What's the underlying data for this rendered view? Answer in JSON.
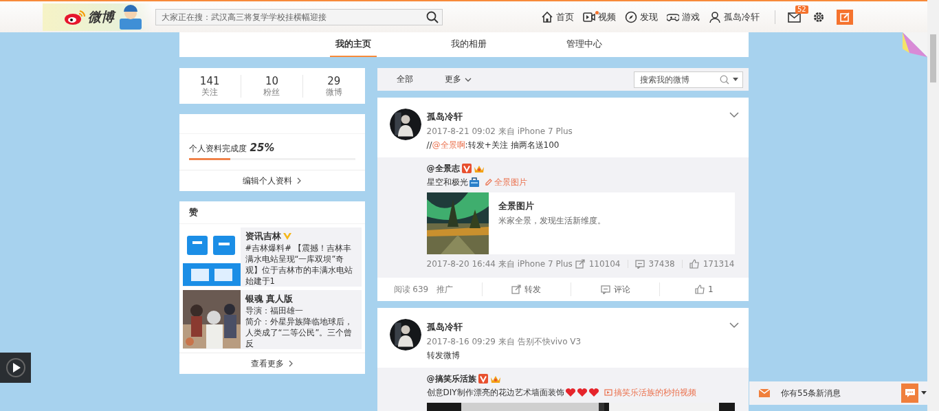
{
  "header": {
    "logo_text": "微博",
    "search": {
      "placeholder": "大家正在搜：武汉高三将复学学校挂横幅迎接"
    },
    "nav": [
      {
        "kind": "home",
        "label": "首页",
        "dot": false
      },
      {
        "kind": "video",
        "label": "视频",
        "dot": true
      },
      {
        "kind": "discover",
        "label": "发现",
        "dot": false
      },
      {
        "kind": "game",
        "label": "游戏",
        "dot": false
      },
      {
        "kind": "user",
        "label": "孤岛冷轩",
        "dot": false
      }
    ],
    "message_badge": "52"
  },
  "tabs": [
    {
      "label": "我的主页",
      "selected": true
    },
    {
      "label": "我的相册",
      "selected": false
    },
    {
      "label": "管理中心",
      "selected": false
    }
  ],
  "stats": [
    {
      "value": "141",
      "label": "关注"
    },
    {
      "value": "10",
      "label": "粉丝"
    },
    {
      "value": "29",
      "label": "微博"
    }
  ],
  "profile": {
    "label": "个人资料完成度",
    "percent": "25%",
    "level": 0.25,
    "edit_link": "编辑个人资料"
  },
  "likes": {
    "title": "赞",
    "more": "查看更多",
    "items": [
      {
        "kind": "logo",
        "title": "资讯吉林",
        "verified": true,
        "lines": [
          "#吉林爆料# 【震撼！吉林丰满水电站呈现“一库双坝”奇观】位于吉林市的丰满水电站始建于1"
        ]
      },
      {
        "kind": "poster",
        "title": "银魂 真人版",
        "verified": false,
        "lines": [
          "导演：福田雄一",
          "简介：外星异族降临地球后，人类成了“二等公民”。三个曾反"
        ]
      }
    ]
  },
  "feed_filter": {
    "items": [
      {
        "kind": "link",
        "label": "全部"
      },
      {
        "kind": "dropdown",
        "label": "更多"
      }
    ],
    "search": {
      "placeholder": "搜索我的微博"
    }
  },
  "posts": [
    {
      "author": "孤岛冷轩",
      "meta": "2017-8-21 09:02 来自 iPhone 7 Plus",
      "text_parts": [
        {
          "kind": "plain",
          "text": "//"
        },
        {
          "kind": "link",
          "text": "@全景啊"
        },
        {
          "kind": "plain",
          "text": ":转发+关注 抽两名送100"
        }
      ],
      "repost": {
        "author": "@全景志",
        "text": "星空和极光",
        "emojis": [
          {
            "kind": "bag"
          }
        ],
        "link": {
          "kind": "page",
          "text": "全景图片"
        },
        "card": {
          "title": "全景图片",
          "description": "米家全景，发现生活新维度。"
        },
        "meta": "2017-8-20 16:44 来自 iPhone 7 Plus",
        "counts": [
          {
            "kind": "share",
            "value": "110104"
          },
          {
            "kind": "comment",
            "value": "37438"
          },
          {
            "kind": "like",
            "value": "171314"
          }
        ]
      },
      "actions": {
        "reads": "阅读 639",
        "promote": "推广",
        "items": [
          {
            "kind": "share",
            "label": "转发"
          },
          {
            "kind": "comment",
            "label": "评论"
          },
          {
            "kind": "like",
            "label": "1"
          }
        ]
      }
    },
    {
      "author": "孤岛冷轩",
      "meta": "2017-8-16 09:29 来自 告别不快vivo V3",
      "text_parts": [
        {
          "kind": "plain",
          "text": "转发微博"
        }
      ],
      "repost": {
        "author": "@搞笑乐活族",
        "text": "创意DIY制作漂亮的花边艺术墙面装饰",
        "emojis": [
          {
            "kind": "heart"
          },
          {
            "kind": "heart"
          },
          {
            "kind": "heart"
          }
        ],
        "link": {
          "kind": "video",
          "text": "搞笑乐活族的秒拍视频"
        }
      }
    }
  ],
  "message_bar": {
    "text": "你有55条新消息"
  }
}
